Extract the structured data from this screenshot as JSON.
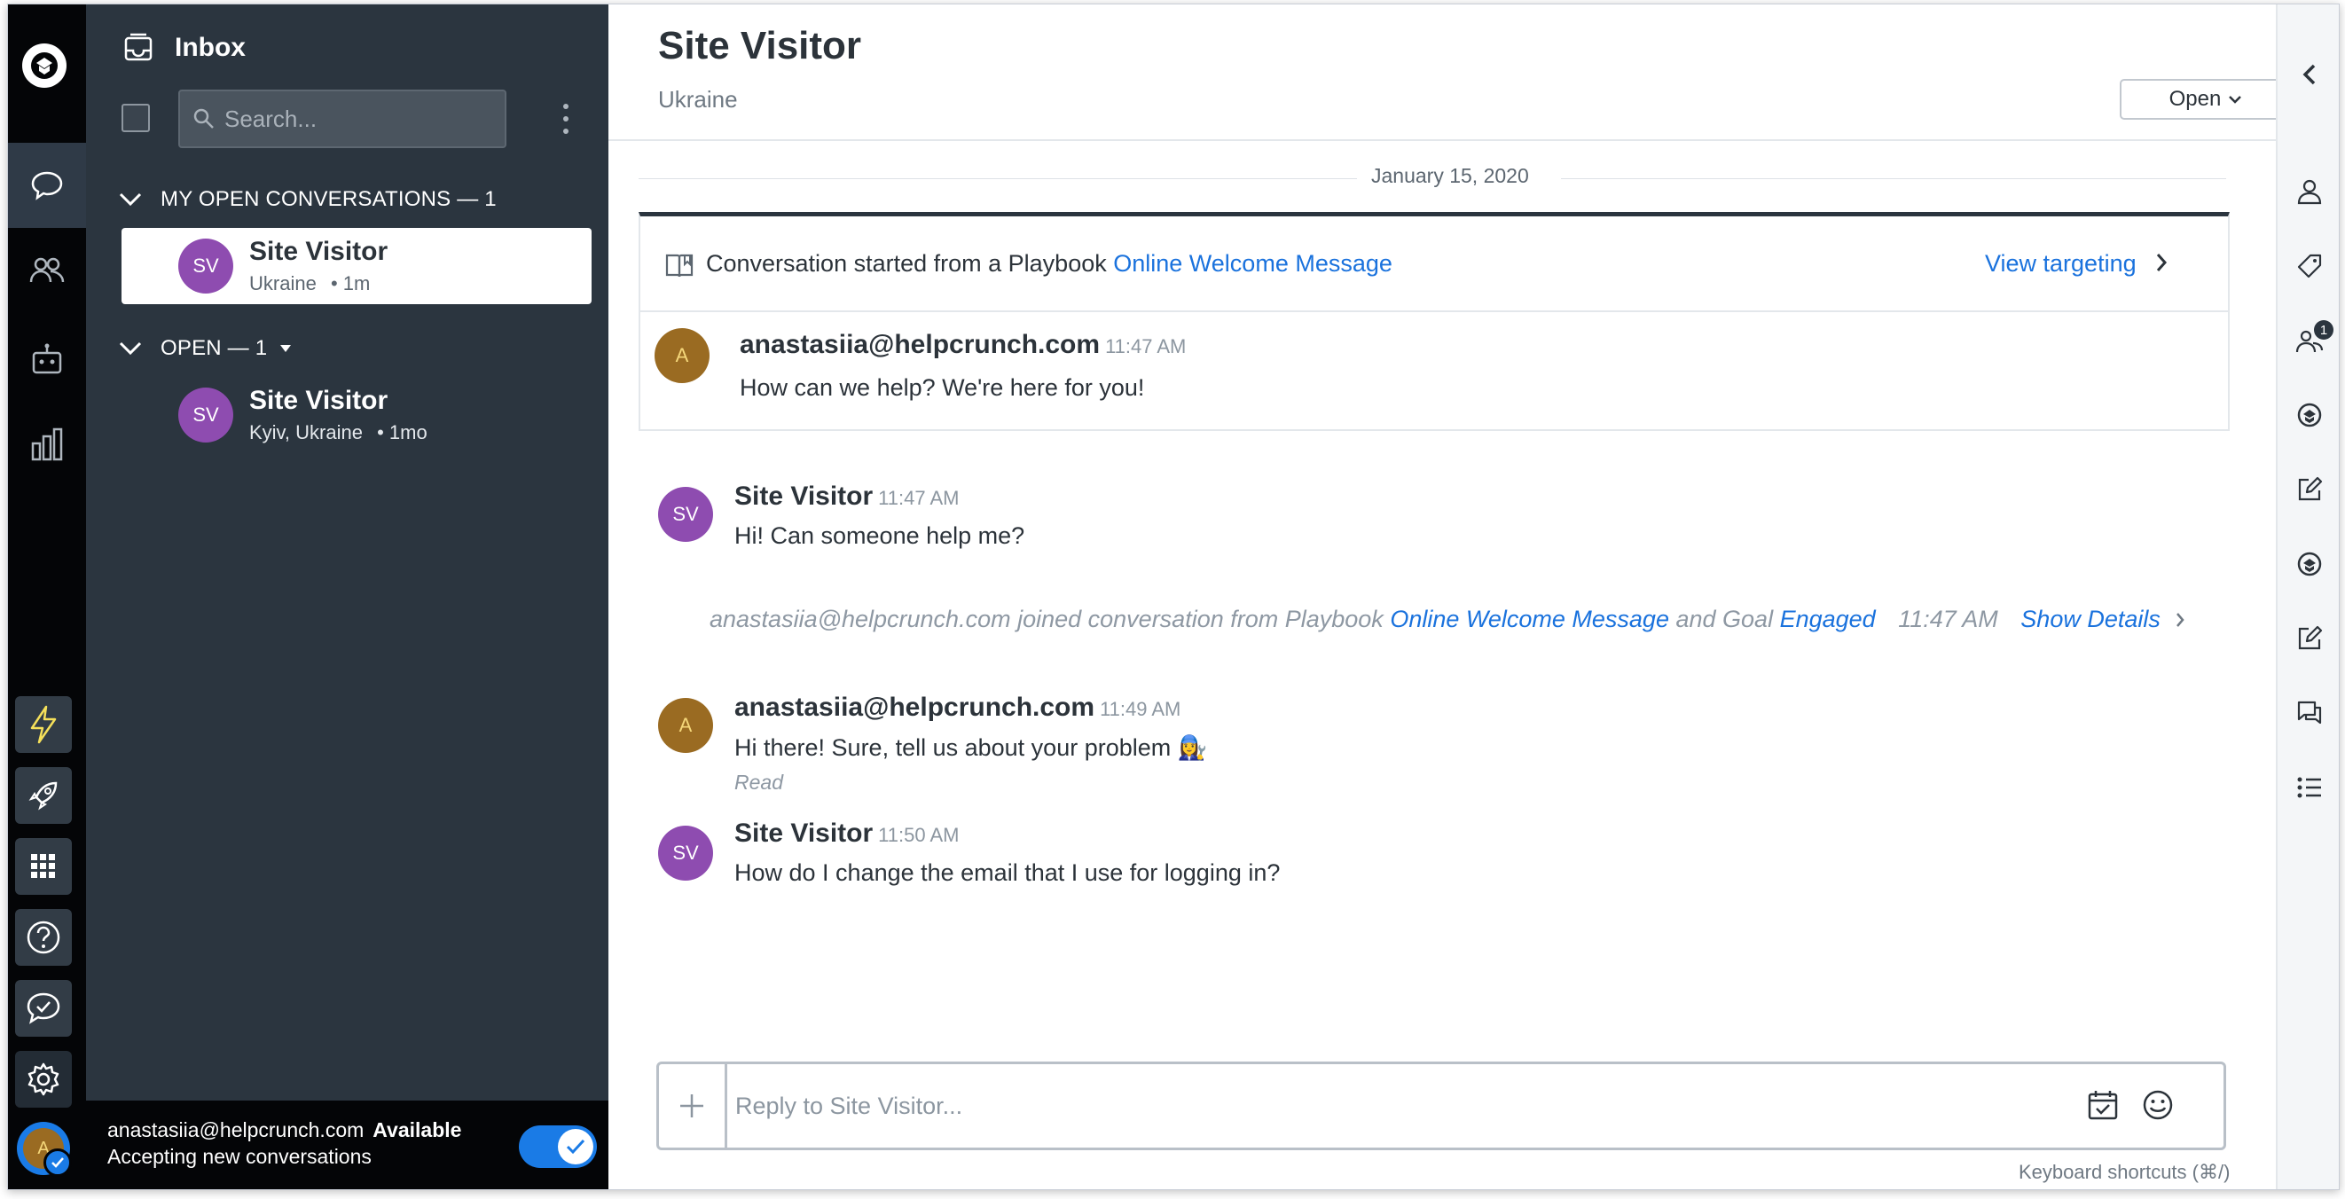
{
  "list": {
    "title": "Inbox",
    "search_placeholder": "Search...",
    "sections": [
      {
        "label": "MY OPEN CONVERSATIONS — 1"
      },
      {
        "label": "OPEN — 1"
      }
    ],
    "conversations": [
      {
        "initials": "SV",
        "name": "Site Visitor",
        "location": "Ukraine",
        "age": "• 1m"
      },
      {
        "initials": "SV",
        "name": "Site Visitor",
        "location": "Kyiv, Ukraine",
        "age": "• 1mo"
      }
    ]
  },
  "status": {
    "email": "anastasiia@helpcrunch.com",
    "availability": "Available",
    "sub": "Accepting new conversations",
    "avatar_initial": "A"
  },
  "header": {
    "title": "Site Visitor",
    "subtitle": "Ukraine",
    "status_button": "Open"
  },
  "thread": {
    "date": "January 15, 2020",
    "playbook": {
      "prefix": "Conversation started from a Playbook",
      "link": "Online Welcome Message",
      "view_targeting": "View targeting",
      "agent_initial": "A",
      "agent": "anastasiia@helpcrunch.com",
      "time": "11:47 AM",
      "text": "How can we help? We're here for you!"
    },
    "messages": [
      {
        "initials": "SV",
        "name": "Site Visitor",
        "time": "11:47 AM",
        "text": "Hi! Can someone help me?"
      },
      {
        "initials": "A",
        "name": "anastasiia@helpcrunch.com",
        "time": "11:49 AM",
        "text": "Hi there! Sure, tell us about your problem 👩‍🔧",
        "receipt": "Read"
      },
      {
        "initials": "SV",
        "name": "Site Visitor",
        "time": "11:50 AM",
        "text": "How do I change the email that I use for logging in?"
      }
    ],
    "system": {
      "prefix": "anastasiia@helpcrunch.com joined conversation from Playbook",
      "playbook": "Online Welcome Message",
      "mid": "and Goal",
      "goal": "Engaged",
      "time": "11:47 AM",
      "details": "Show Details"
    }
  },
  "reply": {
    "placeholder": "Reply to Site Visitor...",
    "shortcuts": "Keyboard shortcuts (⌘/)"
  },
  "right_rail": {
    "badge": "1"
  },
  "colors": {
    "accent": "#1a72dd",
    "sidebar": "#2b353f",
    "rail": "#040507",
    "visitor_avatar": "#8e4cb0",
    "agent_avatar": "#9a6b22"
  }
}
